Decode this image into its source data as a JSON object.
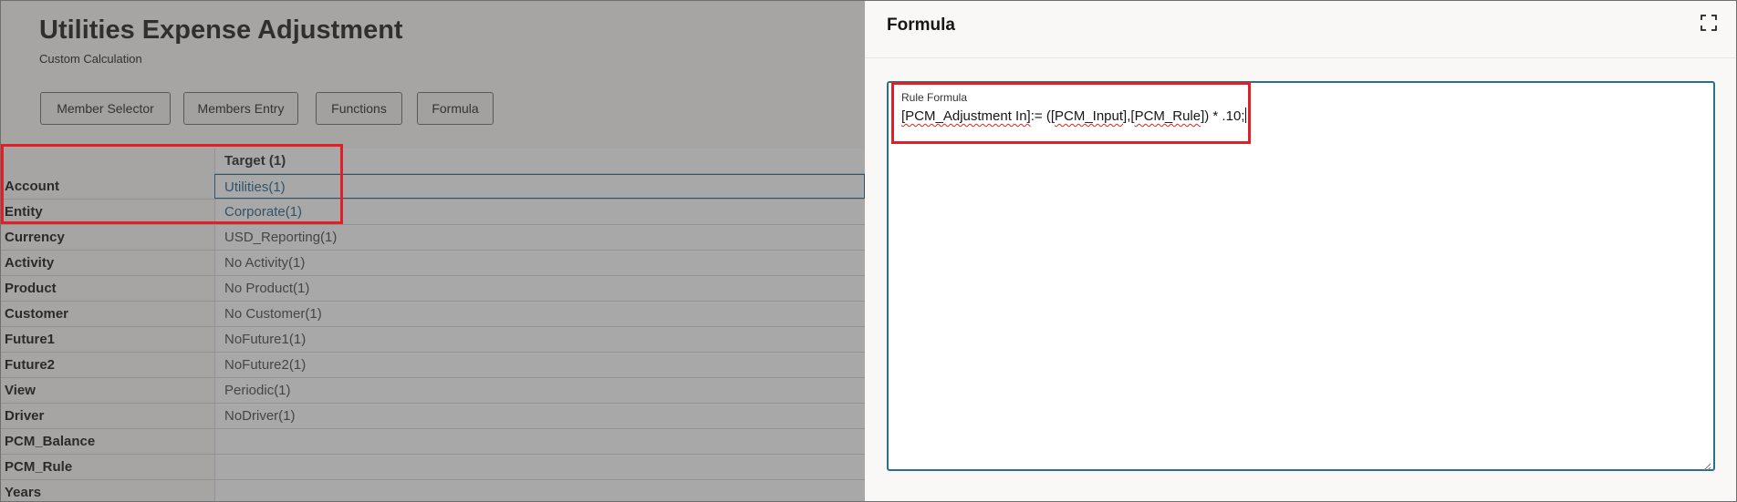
{
  "page": {
    "title": "Utilities Expense Adjustment",
    "subtitle": "Custom Calculation"
  },
  "toolbar": {
    "buttons": [
      "Member Selector",
      "Members Entry",
      "Functions",
      "Formula"
    ]
  },
  "grid": {
    "header": "Target (1)",
    "rows": [
      {
        "label": "Account",
        "value": "Utilities(1)"
      },
      {
        "label": "Entity",
        "value": "Corporate(1)"
      },
      {
        "label": "Currency",
        "value": "USD_Reporting(1)"
      },
      {
        "label": "Activity",
        "value": "No Activity(1)"
      },
      {
        "label": "Product",
        "value": "No Product(1)"
      },
      {
        "label": "Customer",
        "value": "No Customer(1)"
      },
      {
        "label": "Future1",
        "value": "NoFuture1(1)"
      },
      {
        "label": "Future2",
        "value": "NoFuture2(1)"
      },
      {
        "label": "View",
        "value": "Periodic(1)"
      },
      {
        "label": "Driver",
        "value": "NoDriver(1)"
      },
      {
        "label": "PCM_Balance",
        "value": ""
      },
      {
        "label": "PCM_Rule",
        "value": ""
      },
      {
        "label": "Years",
        "value": ""
      }
    ]
  },
  "drawer": {
    "title": "Formula",
    "expand_icon": "expand-icon",
    "field_label": "Rule Formula",
    "formula": {
      "p1": "[PCM_Adjustment In]",
      "p2": ":= ([",
      "p3": "PCM_Input",
      "p4": "],[",
      "p5": "PCM_Rule",
      "p6": "]) * .10;"
    }
  },
  "colors": {
    "highlight": "#e01f26",
    "link": "#1b5f8a",
    "focus_border": "#2a6f93"
  }
}
